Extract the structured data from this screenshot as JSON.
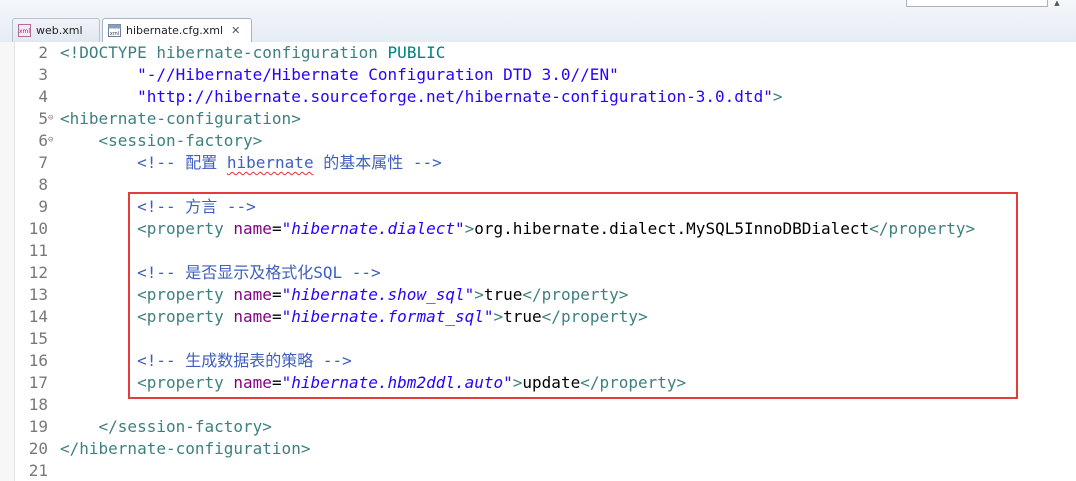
{
  "tabs": [
    {
      "label": "web.xml",
      "active": false,
      "icon": "xml-file-icon"
    },
    {
      "label": "hibernate.cfg.xml",
      "active": true,
      "icon": "xml-file-icon",
      "close": "✕"
    }
  ],
  "editor": {
    "lines": [
      {
        "num": "2",
        "fold": "",
        "segments": [
          [
            "tag",
            "<!"
          ],
          [
            "dt-kw",
            "DOCTYPE"
          ],
          [
            "txt",
            " "
          ],
          [
            "dt-kw",
            "hibernate-configuration"
          ],
          [
            "txt",
            " "
          ],
          [
            "doctype",
            "PUBLIC"
          ]
        ]
      },
      {
        "num": "3",
        "fold": "",
        "segments": [
          [
            "txt",
            "        "
          ],
          [
            "str",
            "\"-//Hibernate/Hibernate Configuration DTD 3.0//EN\""
          ]
        ]
      },
      {
        "num": "4",
        "fold": "",
        "segments": [
          [
            "txt",
            "        "
          ],
          [
            "str",
            "\"http://hibernate.sourceforge.net/hibernate-configuration-3.0.dtd\""
          ],
          [
            "tag",
            ">"
          ]
        ]
      },
      {
        "num": "5",
        "fold": "⊖",
        "segments": [
          [
            "tag",
            "<hibernate-configuration>"
          ]
        ]
      },
      {
        "num": "6",
        "fold": "⊖",
        "segments": [
          [
            "txt",
            "    "
          ],
          [
            "tag",
            "<session-factory>"
          ]
        ]
      },
      {
        "num": "7",
        "fold": "",
        "segments": [
          [
            "txt",
            "        "
          ],
          [
            "cmt",
            "<!-- 配置 "
          ],
          [
            "cmt-sq",
            "hibernate"
          ],
          [
            "cmt",
            " 的基本属性 -->"
          ]
        ]
      },
      {
        "num": "8",
        "fold": "",
        "segments": []
      },
      {
        "num": "9",
        "fold": "",
        "segments": [
          [
            "txt",
            "        "
          ],
          [
            "cmt",
            "<!-- 方言 -->"
          ]
        ]
      },
      {
        "num": "10",
        "fold": "",
        "segments": [
          [
            "txt",
            "        "
          ],
          [
            "tag",
            "<property"
          ],
          [
            "txt",
            " "
          ],
          [
            "attr",
            "name"
          ],
          [
            "txt",
            "="
          ],
          [
            "val",
            "\"hibernate.dialect\""
          ],
          [
            "tag",
            ">"
          ],
          [
            "txt",
            "org.hibernate.dialect.MySQL5InnoDBDialect"
          ],
          [
            "tag",
            "</property>"
          ]
        ]
      },
      {
        "num": "11",
        "fold": "",
        "segments": []
      },
      {
        "num": "12",
        "fold": "",
        "segments": [
          [
            "txt",
            "        "
          ],
          [
            "cmt",
            "<!-- 是否显示及格式化SQL -->"
          ]
        ]
      },
      {
        "num": "13",
        "fold": "",
        "segments": [
          [
            "txt",
            "        "
          ],
          [
            "tag",
            "<property"
          ],
          [
            "txt",
            " "
          ],
          [
            "attr",
            "name"
          ],
          [
            "txt",
            "="
          ],
          [
            "val",
            "\"hibernate.show_sql\""
          ],
          [
            "tag",
            ">"
          ],
          [
            "txt",
            "true"
          ],
          [
            "tag",
            "</property>"
          ]
        ]
      },
      {
        "num": "14",
        "fold": "",
        "segments": [
          [
            "txt",
            "        "
          ],
          [
            "tag",
            "<property"
          ],
          [
            "txt",
            " "
          ],
          [
            "attr",
            "name"
          ],
          [
            "txt",
            "="
          ],
          [
            "val",
            "\"hibernate.format_sql\""
          ],
          [
            "tag",
            ">"
          ],
          [
            "txt",
            "true"
          ],
          [
            "tag",
            "</property>"
          ]
        ]
      },
      {
        "num": "15",
        "fold": "",
        "segments": []
      },
      {
        "num": "16",
        "fold": "",
        "segments": [
          [
            "txt",
            "        "
          ],
          [
            "cmt",
            "<!-- 生成数据表的策略 -->"
          ]
        ]
      },
      {
        "num": "17",
        "fold": "",
        "segments": [
          [
            "txt",
            "        "
          ],
          [
            "tag",
            "<property"
          ],
          [
            "txt",
            " "
          ],
          [
            "attr",
            "name"
          ],
          [
            "txt",
            "="
          ],
          [
            "val",
            "\"hibernate.hbm2ddl.auto\""
          ],
          [
            "tag",
            ">"
          ],
          [
            "txt",
            "update"
          ],
          [
            "tag",
            "</property>"
          ]
        ]
      },
      {
        "num": "18",
        "fold": "",
        "segments": []
      },
      {
        "num": "19",
        "fold": "",
        "segments": [
          [
            "txt",
            "    "
          ],
          [
            "tag",
            "</session-factory>"
          ]
        ]
      },
      {
        "num": "20",
        "fold": "",
        "segments": [
          [
            "tag",
            "</hibernate-configuration>"
          ]
        ]
      },
      {
        "num": "21",
        "fold": "",
        "segments": []
      }
    ]
  },
  "colors": {
    "highlight_box": "#e53b3b",
    "tag": "#3f7f7f",
    "attribute": "#7f007f",
    "value": "#2a00ff",
    "comment": "#3f5fbf"
  }
}
